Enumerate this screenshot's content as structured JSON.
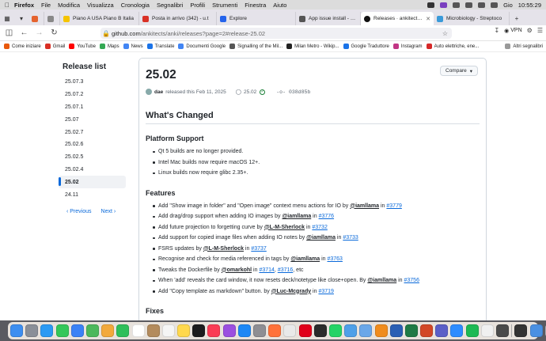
{
  "menubar": {
    "app": "Firefox",
    "items": [
      "File",
      "Modifica",
      "Visualizza",
      "Cronologia",
      "Segnalibri",
      "Profili",
      "Strumenti",
      "Finestra",
      "Aiuto"
    ],
    "date": "Gio",
    "time": "10:55:29"
  },
  "tabs": [
    {
      "label": "Piano A USA Piano B Italia",
      "color": "#f5c400",
      "active": false
    },
    {
      "label": "Posta in arrivo (342) - u.t",
      "color": "#d93025",
      "active": false
    },
    {
      "label": "Explore",
      "color": "#2563eb",
      "active": false
    },
    {
      "label": "App issue install - Supp",
      "color": "#555555",
      "active": false
    },
    {
      "label": "Releases · ankitects/anki",
      "color": "#111111",
      "active": true
    },
    {
      "label": "Microbiology - Streptoco",
      "color": "#3a9ad9",
      "active": false
    }
  ],
  "nav": {
    "url_host": "github.com",
    "url_path": "/ankitects/anki/releases?page=2#release-25.02",
    "vpn_label": "VPN"
  },
  "bookmarks": {
    "items": [
      {
        "label": "Come iniziare",
        "color": "#e8590c"
      },
      {
        "label": "Gmail",
        "color": "#d93025"
      },
      {
        "label": "YouTube",
        "color": "#ff0000"
      },
      {
        "label": "Maps",
        "color": "#34a853"
      },
      {
        "label": "News",
        "color": "#4285f4"
      },
      {
        "label": "Translate",
        "color": "#1a73e8"
      },
      {
        "label": "Documenti Google",
        "color": "#4285f4"
      },
      {
        "label": "Signalling of the Mil...",
        "color": "#555555"
      },
      {
        "label": "Milan Metro - Wikip...",
        "color": "#222222"
      },
      {
        "label": "Google Traduttore",
        "color": "#1a73e8"
      },
      {
        "label": "Instagram",
        "color": "#c13584"
      },
      {
        "label": "Auto elettriche, ene...",
        "color": "#d62828"
      }
    ],
    "other": "Altri segnalibri"
  },
  "sidebar": {
    "title": "Release list",
    "items": [
      "25.07.3",
      "25.07.2",
      "25.07.1",
      "25.07",
      "25.02.7",
      "25.02.6",
      "25.02.5",
      "25.02.4",
      "25.02",
      "24.11"
    ],
    "active_index": 8,
    "prev": "Previous",
    "next": "Next"
  },
  "release": {
    "title": "25.02",
    "compare": "Compare",
    "author": "dae",
    "released_text": "released this Feb 11, 2025",
    "tag": "25.02",
    "commit": "038d85b",
    "whats_changed": "What's Changed",
    "platform_heading": "Platform Support",
    "platform_items": [
      "Qt 5 builds are no longer provided.",
      "Intel Mac builds now require macOS 12+.",
      "Linux builds now require glibc 2.35+."
    ],
    "features_heading": "Features",
    "features": [
      {
        "text": "Add \"Show image in folder\" and \"Open image\" context menu actions for IO by ",
        "user": "@iamllama",
        "in": " in ",
        "links": [
          "#3779"
        ],
        "tail": ""
      },
      {
        "text": "Add drag/drop support when adding IO images by ",
        "user": "@iamllama",
        "in": " in ",
        "links": [
          "#3776"
        ],
        "tail": ""
      },
      {
        "text": "Add future projection to forgetting curve by ",
        "user": "@L-M-Sherlock",
        "in": " in ",
        "links": [
          "#3732"
        ],
        "tail": ""
      },
      {
        "text": "Add support for copied image files when adding IO notes by ",
        "user": "@iamllama",
        "in": " in ",
        "links": [
          "#3733"
        ],
        "tail": ""
      },
      {
        "text": "FSRS updates by ",
        "user": "@L-M-Sherlock",
        "in": " in ",
        "links": [
          "#3737"
        ],
        "tail": ""
      },
      {
        "text": "Recognise and check for media referenced in tags by ",
        "user": "@iamllama",
        "in": " in ",
        "links": [
          "#3763"
        ],
        "tail": ""
      },
      {
        "text": "Tweaks the Dockerfile by ",
        "user": "@omarkohl",
        "in": " in ",
        "links": [
          "#3714",
          "#3716"
        ],
        "tail": ", etc"
      },
      {
        "text": "When 'add' reveals the card window, it now resets deck/notetype like close+open. By ",
        "user": "@iamllama",
        "in": " in ",
        "links": [
          "#3756"
        ],
        "tail": ""
      },
      {
        "text": "Add \"Copy template as markdown\" button. by ",
        "user": "@Luc-Mcgrady",
        "in": " in ",
        "links": [
          "#3719"
        ],
        "tail": ""
      }
    ],
    "fixes_heading": "Fixes"
  },
  "dock": {
    "apps": [
      {
        "name": "finder",
        "color": "#3d8ef0"
      },
      {
        "name": "launchpad",
        "color": "#8a8f98"
      },
      {
        "name": "safari",
        "color": "#2b9af3"
      },
      {
        "name": "messages",
        "color": "#34c759"
      },
      {
        "name": "mail",
        "color": "#3b82f6"
      },
      {
        "name": "maps",
        "color": "#4cb85c"
      },
      {
        "name": "photos",
        "color": "#f2a93b"
      },
      {
        "name": "facetime",
        "color": "#2fbf5a"
      },
      {
        "name": "calendar",
        "color": "#ffffff"
      },
      {
        "name": "contacts",
        "color": "#b38b5d"
      },
      {
        "name": "reminders",
        "color": "#f5f5f5"
      },
      {
        "name": "notes",
        "color": "#ffd84d"
      },
      {
        "name": "tv",
        "color": "#1c1c1e"
      },
      {
        "name": "music",
        "color": "#fa3c55"
      },
      {
        "name": "podcasts",
        "color": "#9b4fe0"
      },
      {
        "name": "app-store",
        "color": "#1e88f5"
      },
      {
        "name": "settings",
        "color": "#8e8e93"
      },
      {
        "name": "firefox",
        "color": "#ff7139"
      },
      {
        "name": "chrome",
        "color": "#e9e9e9"
      },
      {
        "name": "opera",
        "color": "#e0001a"
      },
      {
        "name": "terminal",
        "color": "#2b2b2b"
      },
      {
        "name": "whatsapp",
        "color": "#25d366"
      },
      {
        "name": "anki",
        "color": "#4fa0e8"
      },
      {
        "name": "preview",
        "color": "#6aa7e8"
      },
      {
        "name": "vlc",
        "color": "#f08c1d"
      },
      {
        "name": "word",
        "color": "#2b5fb4"
      },
      {
        "name": "excel",
        "color": "#1f7a45"
      },
      {
        "name": "powerpoint",
        "color": "#d24726"
      },
      {
        "name": "teams",
        "color": "#5b5fc7"
      },
      {
        "name": "zoom",
        "color": "#2d8cff"
      },
      {
        "name": "spotify",
        "color": "#1db954"
      },
      {
        "name": "textedit",
        "color": "#f0f0f0"
      },
      {
        "name": "calculator",
        "color": "#4a4a4a"
      },
      {
        "name": "activity",
        "color": "#333333"
      },
      {
        "name": "downloads",
        "color": "#4a90e2"
      },
      {
        "name": "trash",
        "color": "#c8c8cc"
      }
    ]
  }
}
